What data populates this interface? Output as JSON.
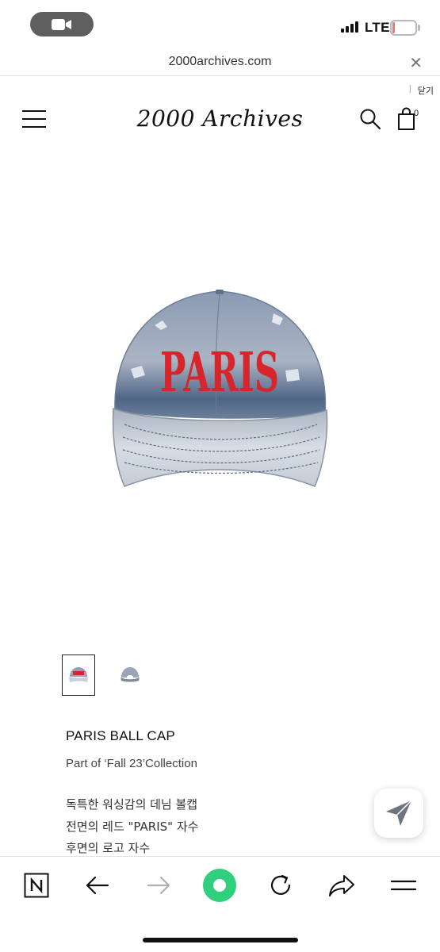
{
  "status_bar": {
    "network": "LTE",
    "battery_level": "10",
    "battery_percent": 10,
    "call_icon": "video-call-icon"
  },
  "browser": {
    "url": "2000archives.com",
    "close_icon": "close-icon"
  },
  "site_header": {
    "close_label": "닫기",
    "logo_text": "2000 Archives",
    "cart_count": "0",
    "menu_icon": "hamburger-menu-icon",
    "search_icon": "search-icon",
    "cart_icon": "shopping-bag-icon"
  },
  "product": {
    "image_text": "PARIS",
    "name": "PARIS BALL CAP",
    "collection": "Part of ‘Fall 23’Collection",
    "description": [
      "독특한 워싱감의 데님 볼캡",
      "전면의 레드 \"PARIS\" 자수",
      "후면의 로고 자수"
    ],
    "thumbnails": [
      "cap-front-thumbnail",
      "cap-back-thumbnail"
    ]
  },
  "toolbar": {
    "items": [
      "naver-home-icon",
      "back-arrow-icon",
      "forward-arrow-icon",
      "green-dot-icon",
      "reload-icon",
      "share-icon",
      "menu-icon"
    ]
  },
  "colors": {
    "accent_green": "#2fcf7e",
    "cap_red": "#d6262c",
    "denim_blue": "#5c7190"
  }
}
